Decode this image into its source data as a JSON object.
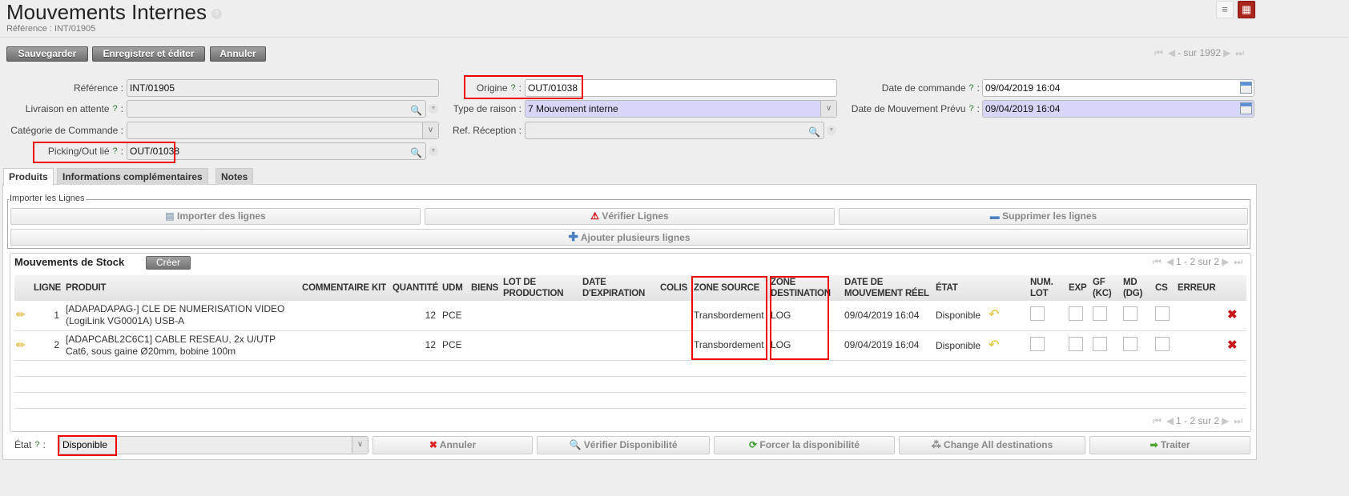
{
  "header": {
    "title": "Mouvements Internes",
    "help": "?",
    "subtitle": "Référence : INT/01905",
    "view_list_icon": "list-view-icon",
    "view_form_icon": "form-view-icon"
  },
  "toolbar": {
    "save": "Sauvegarder",
    "save_edit": "Enregistrer et éditer",
    "cancel": "Annuler"
  },
  "pager": {
    "text": "- sur 1992"
  },
  "form": {
    "reference_label": "Référence :",
    "reference_value": "INT/01905",
    "livraison_label": "Livraison en attente",
    "livraison_value": "",
    "categorie_label": "Catégorie de Commande :",
    "categorie_value": "",
    "picking_label": "Picking/Out lié",
    "picking_value": "OUT/01038",
    "origine_label": "Origine",
    "origine_value": "OUT/01038",
    "type_label": "Type de raison :",
    "type_value": "7 Mouvement interne",
    "refrec_label": "Ref. Réception :",
    "refrec_value": "",
    "datecmd_label": "Date de commande",
    "datecmd_value": "09/04/2019 16:04",
    "datemvt_label": "Date de Mouvement Prévu",
    "datemvt_value": "09/04/2019 16:04",
    "q": "?",
    "colon": ":"
  },
  "tabs": [
    "Produits",
    "Informations complémentaires",
    "Notes"
  ],
  "import": {
    "legend": "Importer les Lignes",
    "import_btn": "Importer des lignes",
    "verify_btn": "Vérifier Lignes",
    "delete_btn": "Supprimer les lignes",
    "add_btn": "Ajouter plusieurs lignes"
  },
  "stock": {
    "title": "Mouvements de Stock",
    "create": "Créer",
    "pager": "1 - 2 sur 2",
    "columns": [
      "LIGNE",
      "PRODUIT",
      "COMMENTAIRE",
      "KIT",
      "QUANTITÉ",
      "UDM",
      "BIENS",
      "LOT DE PRODUCTION",
      "DATE D'EXPIRATION",
      "COLIS",
      "ZONE SOURCE",
      "ZONE DESTINATION",
      "DATE DE MOUVEMENT RÉEL",
      "ÉTAT",
      "NUM. LOT",
      "EXP",
      "GF (KC)",
      "MD (DG)",
      "CS",
      "ERREUR"
    ],
    "rows": [
      {
        "ligne": "1",
        "produit": "[ADAPADAPAG-] CLE DE NUMERISATION VIDEO (LogiLink VG0001A) USB-A",
        "quantite": "12",
        "udm": "PCE",
        "zone_source": "Transbordement",
        "zone_dest": "LOG",
        "date": "09/04/2019 16:04",
        "etat": "Disponible"
      },
      {
        "ligne": "2",
        "produit": "[ADAPCABL2C6C1] CABLE RESEAU, 2x U/UTP Cat6, sous gaine Ø20mm, bobine 100m",
        "quantite": "12",
        "udm": "PCE",
        "zone_source": "Transbordement",
        "zone_dest": "LOG",
        "date": "09/04/2019 16:04",
        "etat": "Disponible"
      }
    ]
  },
  "footer": {
    "etat_label": "État",
    "etat_value": "Disponible",
    "cancel": "Annuler",
    "verify": "Vérifier Disponibilité",
    "force": "Forcer la disponibilité",
    "change": "Change All destinations",
    "process": "Traiter"
  }
}
